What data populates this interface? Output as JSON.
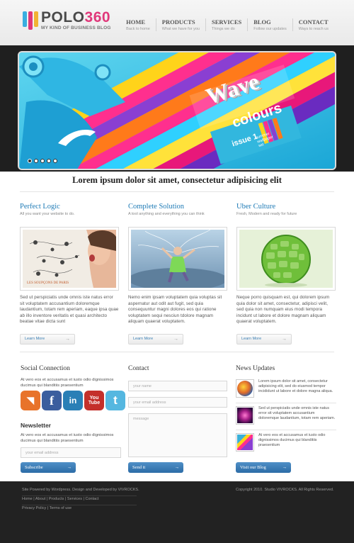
{
  "brand": {
    "name_text": "POLO",
    "name_num": "360",
    "tagline": "MY KIND OF BUSINESS BLOG",
    "bar_colors": [
      "#3aaee0",
      "#e0387a",
      "#f2b233"
    ]
  },
  "nav": [
    {
      "label": "HOME",
      "sub": "Back to home"
    },
    {
      "label": "PRODUCTS",
      "sub": "What we have for you"
    },
    {
      "label": "SERVICES",
      "sub": "Things we do"
    },
    {
      "label": "BLOG",
      "sub": "Follow our updates"
    },
    {
      "label": "CONTACT",
      "sub": "Ways to reach us"
    }
  ],
  "slider": {
    "title_1": "Wave",
    "title_2": "colours",
    "issue": "issue 1",
    "issue_sub_1": "summer",
    "issue_sub_2": "wallpaper",
    "issue_sub_3": "set",
    "active_dot": 0,
    "dot_count": 5
  },
  "tagline": "Lorem ipsum dolor sit amet, consectetur adipisicing elit",
  "features": [
    {
      "title": "Perfect Logic",
      "subtitle": "All you want your website to do.",
      "text": "Sed ut perspiciatis unde omnis iste natus error sit voluptatem accusantium doloremque laudantium, totam rem aperiam, eaque ipsa quae ab illo inventore veritatis et quasi architecto beatae vitae dicta sunt",
      "button": "Learn More"
    },
    {
      "title": "Complete Solution",
      "subtitle": "A tool anything and everything you can think",
      "text": "Nemo enim ipsam voluptatem quia voluptas sit aspernatur aut odit aut fugit, sed quia consequuntur magni dolores eos qui ratione voluptatem sequi nesciun tdolore magnam aliquam quaerat voluptatem.",
      "button": "Learn More"
    },
    {
      "title": "Uber Culture",
      "subtitle": "Fresh, Modern and ready for future",
      "text": "Neque porro quisquam est, qui dolorem ipsum quia dolor sit amet, consectetur, adipisci velit, sed quia non numquam eius modi tempora incidunt ut labore et dolore magnam aliquam quaerat voluptatem.",
      "button": "Learn More"
    }
  ],
  "social": {
    "heading": "Social Connection",
    "text": "At vero eos et accusamus et iusto odio dignissimos ducimus qui blanditiis praesentium",
    "icons": [
      {
        "name": "rss",
        "glyph": "◥",
        "color": "#e8732a"
      },
      {
        "name": "facebook",
        "glyph": "f",
        "color": "#3b5e9e"
      },
      {
        "name": "linkedin",
        "glyph": "in",
        "color": "#2a7fb6"
      },
      {
        "name": "youtube",
        "glyph": "You\nTube",
        "color": "#c4302b"
      },
      {
        "name": "twitter",
        "glyph": "t",
        "color": "#55b7e0"
      }
    ]
  },
  "newsletter": {
    "heading": "Newsletter",
    "text": "At vero eos et accusamus et iusto odio dignissimos ducimus qui blanditiis praesentium",
    "email_placeholder": "your email address",
    "button": "Subscribe"
  },
  "contact": {
    "heading": "Contact",
    "name_placeholder": "your name",
    "email_placeholder": "your email address",
    "message_placeholder": "message",
    "button": "Send it"
  },
  "news": {
    "heading": "News Updates",
    "items": [
      {
        "text": "Lorem ipsum dolor sit amet, consectetur adipisicing elit, sed do eiusmod tempor incididunt ut labore et dolore magna aliqua.",
        "thumb_color": "#e06a2a"
      },
      {
        "text": "Sed ut perspiciatis unde omnis iste natus error sit voluptatem accusantium doloremque laudantium, totam rem aperiam.",
        "thumb_color": "#a8208a"
      },
      {
        "text": "At vero eos et accusamus et iusto odio dignissimos ducimus qui blanditiis praesentium",
        "thumb_color": "#3ab0d8"
      }
    ],
    "button": "Visit our Blog"
  },
  "footer": {
    "credit": "Site Powered by Wordpress. Design and Developed by VIVROCKS.",
    "links_1": "Home | About | Products | Services | Contact",
    "links_2": "Privacy Policy | Terms of use",
    "copyright": "Copyright 2010. Studio VIVROCKS. All Rights Reserved."
  }
}
